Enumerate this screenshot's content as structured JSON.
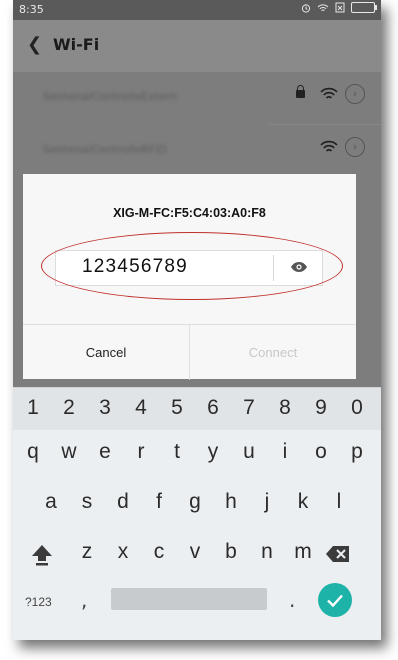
{
  "status_bar": {
    "time": "8:35"
  },
  "header": {
    "back_icon": "chevron-left-icon",
    "title": "Wi-Fi"
  },
  "networks": [
    {
      "name": "SentenaiControlloExtern",
      "locked": true
    },
    {
      "name": "SentenaiControlloRFID",
      "locked": false
    }
  ],
  "dialog": {
    "network_name": "XIG-M-FC:F5:C4:03:A0:F8",
    "password_value": "123456789",
    "cancel_label": "Cancel",
    "connect_label": "Connect"
  },
  "keyboard": {
    "number_row": [
      "1",
      "2",
      "3",
      "4",
      "5",
      "6",
      "7",
      "8",
      "9",
      "0"
    ],
    "row1": [
      "q",
      "w",
      "e",
      "r",
      "t",
      "y",
      "u",
      "i",
      "o",
      "p"
    ],
    "row2": [
      "a",
      "s",
      "d",
      "f",
      "g",
      "h",
      "j",
      "k",
      "l"
    ],
    "row3": [
      "z",
      "x",
      "c",
      "v",
      "b",
      "n",
      "m"
    ],
    "symbols_label": "?123",
    "comma": ",",
    "period": "."
  },
  "colors": {
    "accent": "#1db3a8",
    "annotation": "#c0302a"
  }
}
